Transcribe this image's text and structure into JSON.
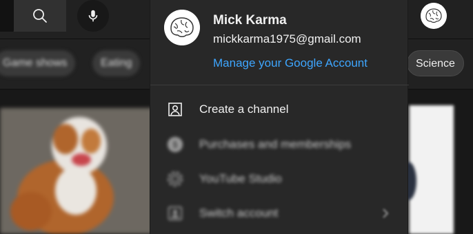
{
  "account": {
    "name": "Mick Karma",
    "email": "mickkarma1975@gmail.com",
    "manage_link": "Manage your Google Account"
  },
  "chips": [
    {
      "label": "Game shows"
    },
    {
      "label": "Eating"
    },
    {
      "label": "Science"
    }
  ],
  "menu": {
    "items": [
      {
        "label": "Create a channel",
        "icon": "create-channel-icon"
      },
      {
        "label": "Purchases and memberships",
        "icon": "dollar-icon"
      },
      {
        "label": "YouTube Studio",
        "icon": "studio-gear-icon"
      },
      {
        "label": "Switch account",
        "icon": "switch-account-icon",
        "has_submenu": true
      }
    ]
  },
  "colors": {
    "link": "#3ea6ff",
    "menu_bg": "#282828",
    "topbar_bg": "#212121"
  },
  "icons": [
    "search-icon",
    "mic-icon",
    "avatar",
    "chevron-right-icon"
  ]
}
